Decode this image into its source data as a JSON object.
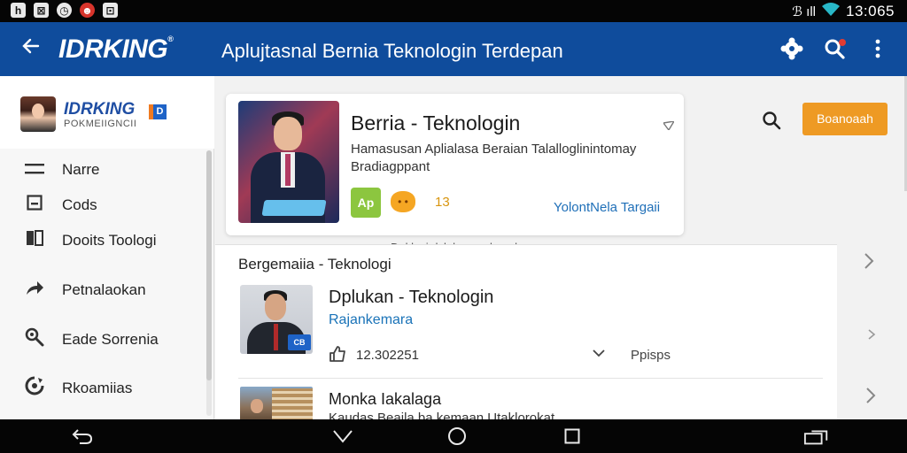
{
  "status_bar": {
    "left_icons": [
      "h",
      "⊠",
      "◷",
      "☻",
      "⊡"
    ],
    "signal": "ℬ ıll",
    "time": "13:065"
  },
  "app_bar": {
    "brand": "IDRKING",
    "brand_mark": "®",
    "title": "Aplujtasnal Bernia Teknologin Terdepan"
  },
  "sidebar": {
    "profile": {
      "name": "IDRKING",
      "subtitle": "POKMEIIGNCII",
      "badge": "D"
    },
    "items": [
      {
        "label": "Narre"
      },
      {
        "label": "Cods"
      },
      {
        "label": "Dooits Toologi"
      },
      {
        "label": "Petnalaokan"
      },
      {
        "label": "Eade Sorrenia"
      },
      {
        "label": "Rkoamiias"
      }
    ]
  },
  "feature": {
    "title": "Berria - Teknologin",
    "description": "Hamasusan Aplialasa Beraian Talalloglinintomay Bradiagppant",
    "badge": "Ap",
    "count": "13",
    "link": "YolontNela Targaii",
    "cut_text": "Doklasi dsk hocusok ao hoocosoo paoocn"
  },
  "toolbar": {
    "cta_label": "Boanoaah"
  },
  "list": {
    "section_title": "Bergemaiia - Teknologi",
    "item1": {
      "title": "Dplukan - Teknologin",
      "source": "Rajankemara",
      "logo": "CB",
      "meta": "12.302251",
      "extra": "Ppisps"
    },
    "item2": {
      "title": "Monka Iakalaga",
      "subtitle": "Kaudas Beaila ba kemaan Utaklorokat"
    }
  }
}
